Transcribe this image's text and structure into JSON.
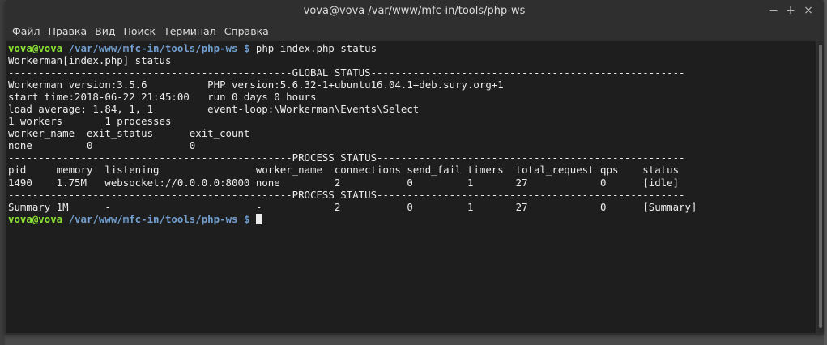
{
  "window": {
    "title": "vova@vova /var/www/mfc-in/tools/php-ws",
    "minimize_glyph": "−",
    "maximize_glyph": "+",
    "close_glyph": "×"
  },
  "menu": [
    "Файл",
    "Правка",
    "Вид",
    "Поиск",
    "Терминал",
    "Справка"
  ],
  "terminal": {
    "prompt_user": "vova@vova",
    "prompt_path": "/var/www/mfc-in/tools/php-ws",
    "prompt_symbol": "$",
    "command": "php index.php status",
    "output": [
      "Workerman[index.php] status",
      "-----------------------------------------------GLOBAL STATUS----------------------------------------------------",
      "Workerman version:3.5.6          PHP version:5.6.32-1+ubuntu16.04.1+deb.sury.org+1",
      "start time:2018-06-22 21:45:00   run 0 days 0 hours",
      "load average: 1.84, 1, 1         event-loop:\\Workerman\\Events\\Select",
      "1 workers       1 processes",
      "worker_name  exit_status      exit_count",
      "none         0                0",
      "-----------------------------------------------PROCESS STATUS---------------------------------------------------",
      "pid     memory  listening                worker_name  connections send_fail timers  total_request qps    status",
      "1490    1.75M   websocket://0.0.0.0:8000 none         2           0         1       27            0      [idle]",
      "-----------------------------------------------PROCESS STATUS---------------------------------------------------",
      "Summary 1M      -                        -            2           0         1       27            0      [Summary]"
    ]
  },
  "colors": {
    "prompt_user": "#8ae234",
    "prompt_path": "#729fcf",
    "terminal_bg": "#1e1e1e",
    "terminal_fg": "#ececec",
    "chrome_bg": "#2f2f2f"
  }
}
